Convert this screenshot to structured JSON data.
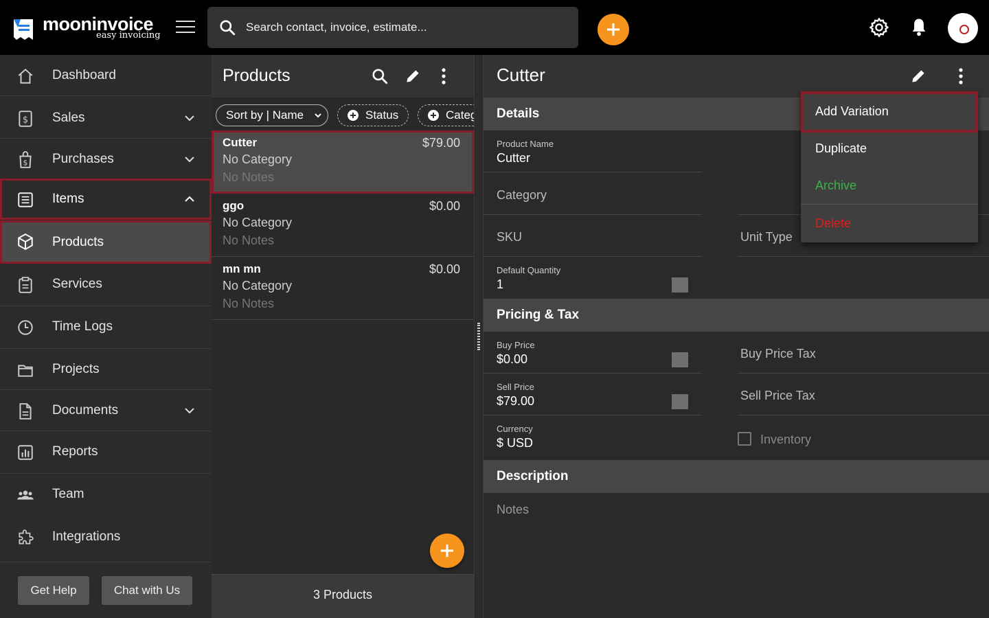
{
  "app": {
    "name": "mooninvoice",
    "tagline": "easy invoicing"
  },
  "search": {
    "placeholder": "Search contact, invoice, estimate..."
  },
  "sidebar": {
    "items": [
      {
        "label": "Dashboard",
        "icon": "home-icon"
      },
      {
        "label": "Sales",
        "icon": "sales-icon",
        "expandable": true
      },
      {
        "label": "Purchases",
        "icon": "purchases-icon",
        "expandable": true
      },
      {
        "label": "Items",
        "icon": "items-icon",
        "expanded": true
      },
      {
        "label": "Products",
        "icon": "box-icon",
        "selected": true
      },
      {
        "label": "Services",
        "icon": "services-icon"
      },
      {
        "label": "Time Logs",
        "icon": "clock-icon"
      },
      {
        "label": "Projects",
        "icon": "folder-icon"
      },
      {
        "label": "Documents",
        "icon": "document-icon",
        "expandable": true
      },
      {
        "label": "Reports",
        "icon": "reports-icon"
      },
      {
        "label": "Team",
        "icon": "team-icon"
      },
      {
        "label": "Integrations",
        "icon": "puzzle-icon"
      }
    ],
    "get_help": "Get Help",
    "chat": "Chat with Us"
  },
  "list": {
    "title": "Products",
    "sort_label": "Sort by | Name",
    "filter_status": "Status",
    "filter_category": "Category",
    "products": [
      {
        "name": "Cutter",
        "price": "$79.00",
        "category": "No Category",
        "notes": "No Notes"
      },
      {
        "name": "ggo",
        "price": "$0.00",
        "category": "No Category",
        "notes": "No Notes"
      },
      {
        "name": "mn mn",
        "price": "$0.00",
        "category": "No Category",
        "notes": "No Notes"
      }
    ],
    "footer": "3 Products"
  },
  "detail": {
    "title": "Cutter",
    "section_details": "Details",
    "product_name_label": "Product Name",
    "product_name": "Cutter",
    "category_label": "Category",
    "sku_label": "SKU",
    "unit_type_label": "Unit Type",
    "default_qty_label": "Default Quantity",
    "default_qty": "1",
    "section_pricing": "Pricing & Tax",
    "buy_price_label": "Buy Price",
    "buy_price": "$0.00",
    "buy_price_tax_label": "Buy Price Tax",
    "sell_price_label": "Sell Price",
    "sell_price": "$79.00",
    "sell_price_tax_label": "Sell Price Tax",
    "currency_label": "Currency",
    "currency": "$ USD",
    "inventory_label": "Inventory",
    "section_description": "Description",
    "notes_label": "Notes"
  },
  "menu": {
    "add_variation": "Add Variation",
    "duplicate": "Duplicate",
    "archive": "Archive",
    "delete": "Delete"
  },
  "colors": {
    "accent": "#f7941d",
    "highlight": "#8b1a2a",
    "archive": "#3cb34a",
    "delete": "#e01d1d"
  }
}
